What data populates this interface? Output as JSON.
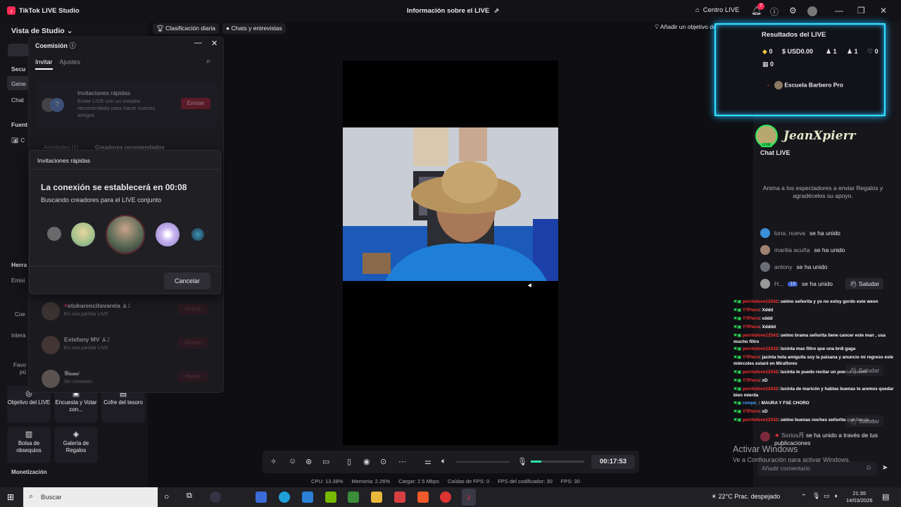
{
  "app": {
    "title": "TikTok LIVE Studio",
    "live_info": "Información sobre el LIVE",
    "center_live": "Centro LIVE",
    "notifications": "7"
  },
  "top_pills": {
    "ranking": "Clasificación diaria",
    "chats": "Chats y entrevistas",
    "add_goal": "Añadir un objetivo de Regalos"
  },
  "left": {
    "studio_view": "Vista de Studio",
    "sections": [
      "Secu",
      "Gene",
      "Chat",
      "Fuent",
      "C",
      "Herra",
      "Emisi",
      "Coe",
      "Intera",
      "Favo",
      "pú"
    ],
    "tools": [
      {
        "label": "Objetivo del LIVE"
      },
      {
        "label": "Encuesta y Votar con..."
      },
      {
        "label": "Cofre del tesoro"
      },
      {
        "label": "Bolsa de obsequios"
      },
      {
        "label": "Galería de Regalos"
      }
    ],
    "monetization": "Monetización"
  },
  "commission": {
    "title": "Coemisión",
    "tabs": [
      "Invitar",
      "Ajustes"
    ],
    "quick_invites": {
      "title": "Invitaciones rápidas",
      "desc": "Emite LIVE con un creador recomendado para hacer nuevos amigos",
      "send": "Enviar"
    },
    "friend_tabs": [
      "Amistades (1)",
      "Creadores recomendados"
    ],
    "rows": [
      {
        "name": "ʚtukarencitavarela",
        "status": "En una partida LIVE",
        "count": "1",
        "btn": "Unirse"
      },
      {
        "name": "Estefany MV",
        "status": "En una partida LIVE",
        "count": "2",
        "btn": "Unirse"
      },
      {
        "name": "𝒴𝒶𝓂𝒾",
        "status": "Sin conexión",
        "count": "",
        "btn": "Invitar"
      }
    ]
  },
  "modal": {
    "title": "Invitaciones rápidas",
    "connection": "La conexión se establecerá en 00:08",
    "searching": "Buscando creadores para el LIVE conjunto",
    "cancel": "Cancelar"
  },
  "controls": {
    "timer": "00:17:53",
    "mic_level": 0.2
  },
  "stats": {
    "cpu": "CPU:  13.38%",
    "memory": "Memoria:  2.26%",
    "load": "Cargar:  2.5 Mbps",
    "fps_drops": "Caídas de FPS:  0",
    "encoder_fps": "FPS del codificador:  30",
    "fps": "FPS:  30"
  },
  "results": {
    "title": "Resultados del LIVE",
    "coins": "0",
    "usd": "USD0.00",
    "viewers": "1",
    "followers": "1",
    "likes": "0",
    "gifts": "0",
    "top_user": "Escuela Barbero Pro"
  },
  "chat": {
    "overlay_name": "JeanXpierr",
    "live_badge": "LIVE",
    "title": "Chat LIVE",
    "cta": "Anima a los espectadores a enviar Regalos y agradéceles su apoyo.",
    "joins": [
      {
        "name": "luna. nueva",
        "action": "se ha unido"
      },
      {
        "name": "marilia acuña",
        "action": "se ha unido"
      },
      {
        "name": "antony",
        "action": "se ha unido"
      },
      {
        "name": "H...",
        "level": "19",
        "action": "se ha unido"
      }
    ],
    "greet": "Saludar",
    "lower_joins": [
      {
        "name": "Sorius月",
        "action": "se ha unido a través de tus publicaciones"
      }
    ],
    "comment_placeholder": "Añadir comentario"
  },
  "overlay_chat": [
    {
      "user": "perritolove12542",
      "text": ": uelmo señorita y yo no estoy gordo este weon"
    },
    {
      "user": "YTPiero",
      "text": ": Xddd"
    },
    {
      "user": "YTPiero",
      "text": ": xddd"
    },
    {
      "user": "YTPiero",
      "text": ": Xdddd"
    },
    {
      "user": "perritolove12542",
      "text": ": uelmo brama señorita tiene cancer este man , usa mucho filtro"
    },
    {
      "user": "perritolove12542",
      "text": ": lucinta mas filtro que una brdi gaga"
    },
    {
      "user": "YTPiero",
      "text": ": jacinta hola amiguita soy la paisana y anuncio mi regreso este miércoles estaré en Miraflores"
    },
    {
      "user": "perritolove12542",
      "text": ": lucinta te puedo recitar un poema wabon"
    },
    {
      "user": "YTPiero",
      "text": ": xD"
    },
    {
      "user": "perritolove12542",
      "text": ": lucinta de maricón y hablas buenas te aremos quedar bien mierda"
    },
    {
      "user": "rompe_",
      "text": ": MAURA Y FSE CHORO"
    },
    {
      "user": "YTPiero",
      "text": ": xD"
    },
    {
      "user": "perritolove12542",
      "text": ": uelmo buenas noches señorita que Bauda ..."
    }
  ],
  "watermark": {
    "line1": "Activar Windows",
    "line2": "Ve a Configuración para activar Windows."
  },
  "taskbar": {
    "search": "Buscar",
    "weather": "22°C  Prac. despejado",
    "time": "21:35",
    "date": "14/03/2026"
  }
}
